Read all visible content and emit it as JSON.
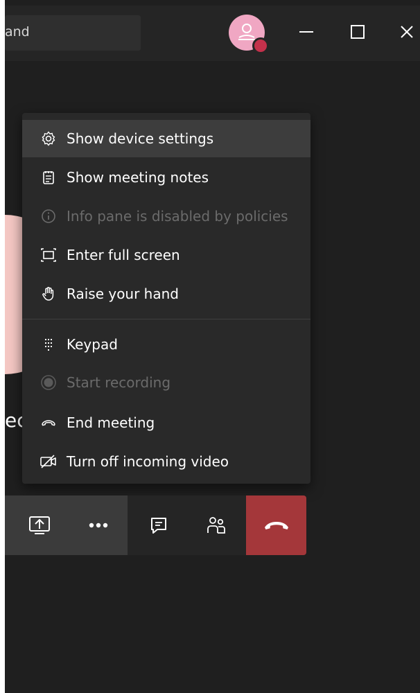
{
  "titlebar": {
    "search_text": "and"
  },
  "icons": {
    "settings": "gear-icon",
    "notes": "notes-icon",
    "info": "info-icon",
    "fullscreen": "fullscreen-icon",
    "hand": "raise-hand-icon",
    "keypad": "keypad-icon",
    "record": "record-icon",
    "end": "end-meeting-icon",
    "video_off": "video-off-icon"
  },
  "menu": {
    "items": [
      {
        "label": "Show device settings"
      },
      {
        "label": "Show meeting notes"
      },
      {
        "label": "Info pane is disabled by policies"
      },
      {
        "label": "Enter full screen"
      },
      {
        "label": "Raise your hand"
      },
      {
        "label": "Keypad"
      },
      {
        "label": "Start recording"
      },
      {
        "label": "End meeting"
      },
      {
        "label": "Turn off incoming video"
      }
    ]
  },
  "stage": {
    "name_fragment": "ec"
  },
  "colors": {
    "accent_hangup": "#a4373a",
    "avatar": "#f0a7c3",
    "presence_busy": "#c4314b"
  }
}
